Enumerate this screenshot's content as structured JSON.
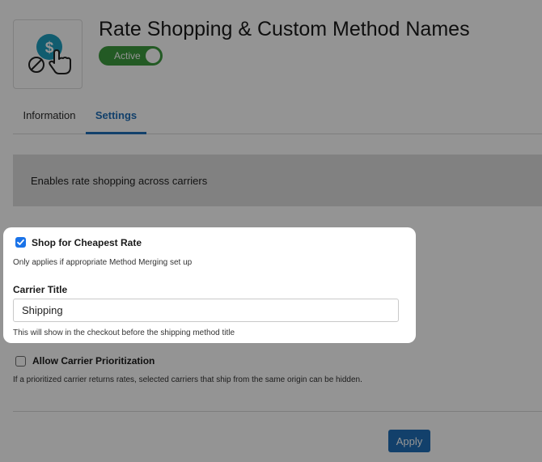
{
  "header": {
    "title": "Rate Shopping & Custom Method Names",
    "status_toggle": {
      "label": "Active",
      "on": true,
      "color": "#3d9b3f"
    },
    "logo": {
      "icon": "dollar-hand-pointer-icon",
      "accent": "#1e9fc0"
    }
  },
  "tabs": [
    {
      "label": "Information",
      "active": false
    },
    {
      "label": "Settings",
      "active": true
    }
  ],
  "description": "Enables rate shopping across carriers",
  "settings": {
    "cheapest_rate": {
      "label": "Shop for Cheapest Rate",
      "checked": true,
      "hint": "Only applies if appropriate Method Merging set up"
    },
    "carrier_title": {
      "label": "Carrier Title",
      "value": "Shipping",
      "hint": "This will show in the checkout before the shipping method title"
    },
    "carrier_prioritization": {
      "label": "Allow Carrier Prioritization",
      "checked": false,
      "hint": "If a prioritized carrier returns rates, selected carriers that ship from the same origin can be hidden."
    }
  },
  "actions": {
    "apply_label": "Apply",
    "color": "#1f6fb8"
  }
}
